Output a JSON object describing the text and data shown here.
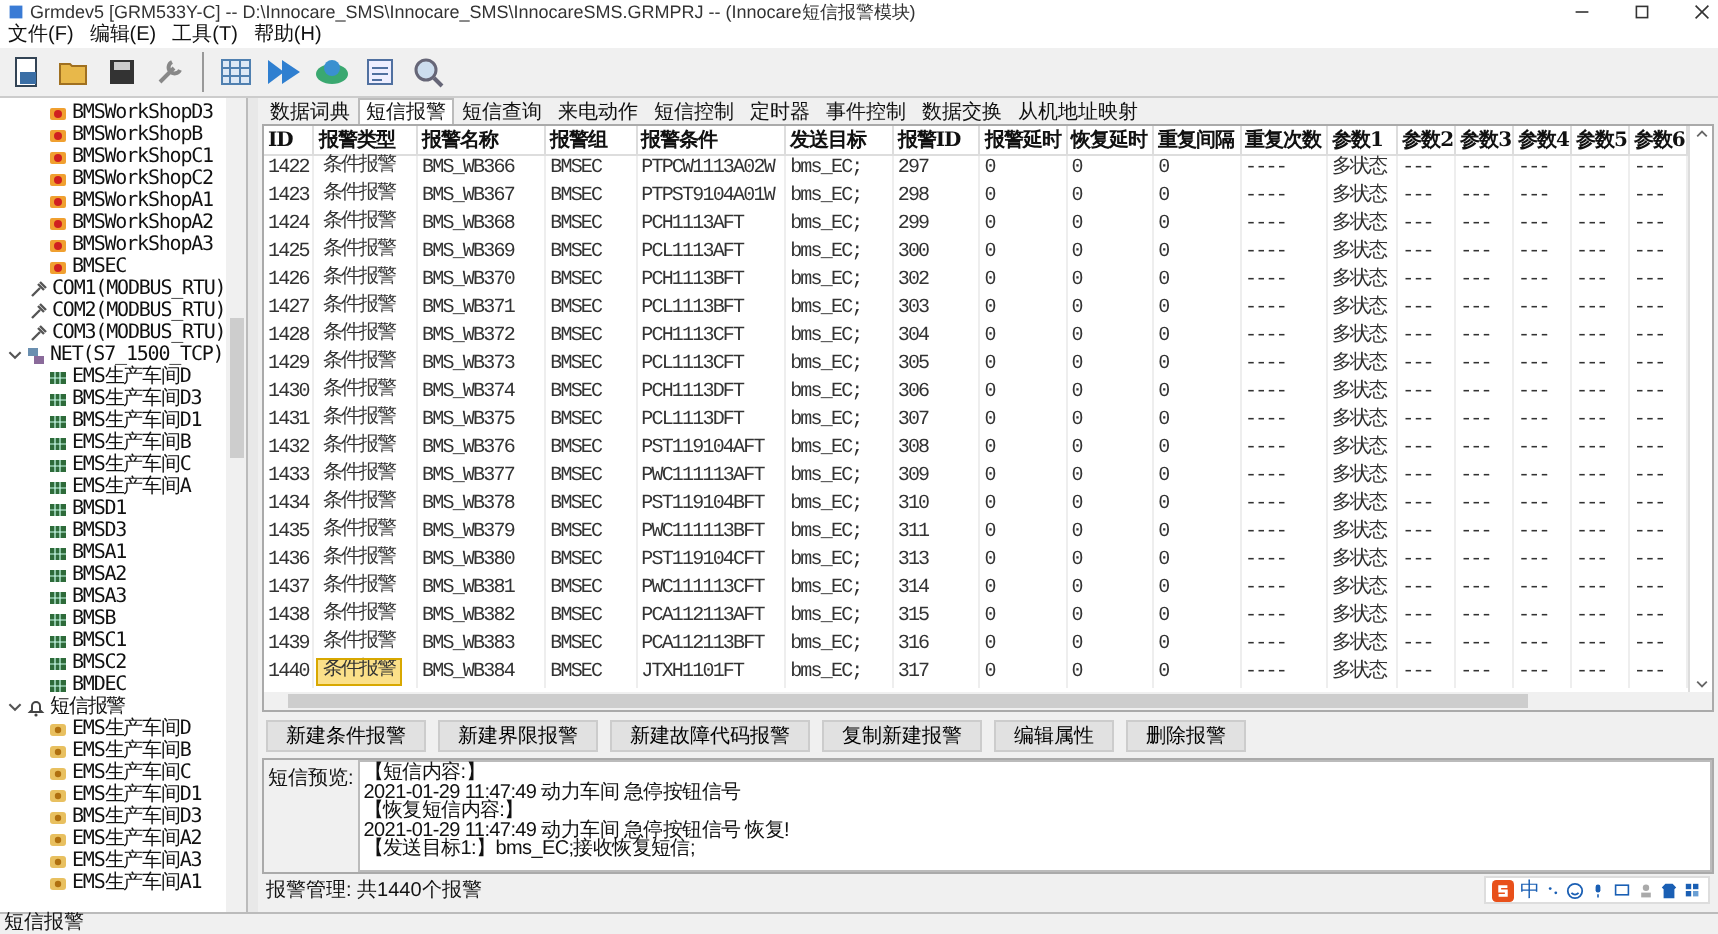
{
  "window": {
    "title": "Grmdev5 [GRM533Y-C] -- D:\\Innocare_SMS\\Innocare_SMS\\InnocareSMS.GRMPRJ -- (Innocare短信报警模块)"
  },
  "menu": [
    "文件(F)",
    "编辑(E)",
    "工具(T)",
    "帮助(H)"
  ],
  "tree": {
    "continued_items": [
      {
        "label": "BMSWorkShopD3",
        "kind": "device"
      },
      {
        "label": "BMSWorkShopB",
        "kind": "device"
      },
      {
        "label": "BMSWorkShopC1",
        "kind": "device"
      },
      {
        "label": "BMSWorkShopC2",
        "kind": "device"
      },
      {
        "label": "BMSWorkShopA1",
        "kind": "device"
      },
      {
        "label": "BMSWorkShopA2",
        "kind": "device"
      },
      {
        "label": "BMSWorkShopA3",
        "kind": "device"
      },
      {
        "label": "BMSEC",
        "kind": "device"
      }
    ],
    "nodes": [
      {
        "label": "COM1(MODBUS_RTU)",
        "kind": "port"
      },
      {
        "label": "COM2(MODBUS_RTU)",
        "kind": "port"
      },
      {
        "label": "COM3(MODBUS_RTU)",
        "kind": "port"
      },
      {
        "label": "NET(S7_1500_TCP)",
        "kind": "network",
        "expanded": true,
        "children": [
          {
            "label": "EMS生产车间D",
            "kind": "tag"
          },
          {
            "label": "BMS生产车间D3",
            "kind": "tag"
          },
          {
            "label": "BMS生产车间D1",
            "kind": "tag"
          },
          {
            "label": "EMS生产车间B",
            "kind": "tag"
          },
          {
            "label": "EMS生产车间C",
            "kind": "tag"
          },
          {
            "label": "EMS生产车间A",
            "kind": "tag"
          },
          {
            "label": "BMSD1",
            "kind": "tag"
          },
          {
            "label": "BMSD3",
            "kind": "tag"
          },
          {
            "label": "BMSA1",
            "kind": "tag"
          },
          {
            "label": "BMSA2",
            "kind": "tag"
          },
          {
            "label": "BMSA3",
            "kind": "tag"
          },
          {
            "label": "BMSB",
            "kind": "tag"
          },
          {
            "label": "BMSC1",
            "kind": "tag"
          },
          {
            "label": "BMSC2",
            "kind": "tag"
          },
          {
            "label": "BMDEC",
            "kind": "tag"
          }
        ]
      },
      {
        "label": "短信报警",
        "kind": "alarm",
        "expanded": true,
        "children": [
          {
            "label": "EMS生产车间D",
            "kind": "sms"
          },
          {
            "label": "EMS生产车间B",
            "kind": "sms"
          },
          {
            "label": "EMS生产车间C",
            "kind": "sms"
          },
          {
            "label": "EMS生产车间D1",
            "kind": "sms"
          },
          {
            "label": "BMS生产车间D3",
            "kind": "sms"
          },
          {
            "label": "EMS生产车间A2",
            "kind": "sms"
          },
          {
            "label": "EMS生产车间A3",
            "kind": "sms"
          },
          {
            "label": "EMS生产车间A1",
            "kind": "sms"
          }
        ]
      }
    ]
  },
  "tabs": [
    {
      "label": "数据词典",
      "selected": false
    },
    {
      "label": "短信报警",
      "selected": true
    },
    {
      "label": "短信查询",
      "selected": false
    },
    {
      "label": "来电动作",
      "selected": false
    },
    {
      "label": "短信控制",
      "selected": false
    },
    {
      "label": "定时器",
      "selected": false
    },
    {
      "label": "事件控制",
      "selected": false
    },
    {
      "label": "数据交换",
      "selected": false
    },
    {
      "label": "从机地址映射",
      "selected": false
    }
  ],
  "table": {
    "columns": [
      "ID",
      "报警类型",
      "报警名称",
      "报警组",
      "报警条件",
      "发送目标",
      "报警ID",
      "报警延时",
      "恢复延时",
      "重复间隔",
      "重复次数",
      "参数1",
      "参数2",
      "参数3",
      "参数4",
      "参数5",
      "参数6"
    ],
    "rows": [
      {
        "selected": false,
        "cells": [
          "1422",
          "条件报警",
          "BMS_WB366",
          "BMSEC",
          "PTPCW1113A02W",
          "bms_EC;",
          "297",
          "0",
          "0",
          "0",
          "----",
          "多状态",
          "---",
          "---",
          "---",
          "---",
          "---"
        ]
      },
      {
        "selected": false,
        "cells": [
          "1423",
          "条件报警",
          "BMS_WB367",
          "BMSEC",
          "PTPST9104A01W",
          "bms_EC;",
          "298",
          "0",
          "0",
          "0",
          "----",
          "多状态",
          "---",
          "---",
          "---",
          "---",
          "---"
        ]
      },
      {
        "selected": false,
        "cells": [
          "1424",
          "条件报警",
          "BMS_WB368",
          "BMSEC",
          "PCH1113AFT",
          "bms_EC;",
          "299",
          "0",
          "0",
          "0",
          "----",
          "多状态",
          "---",
          "---",
          "---",
          "---",
          "---"
        ]
      },
      {
        "selected": false,
        "cells": [
          "1425",
          "条件报警",
          "BMS_WB369",
          "BMSEC",
          "PCL1113AFT",
          "bms_EC;",
          "300",
          "0",
          "0",
          "0",
          "----",
          "多状态",
          "---",
          "---",
          "---",
          "---",
          "---"
        ]
      },
      {
        "selected": false,
        "cells": [
          "1426",
          "条件报警",
          "BMS_WB370",
          "BMSEC",
          "PCH1113BFT",
          "bms_EC;",
          "302",
          "0",
          "0",
          "0",
          "----",
          "多状态",
          "---",
          "---",
          "---",
          "---",
          "---"
        ]
      },
      {
        "selected": false,
        "cells": [
          "1427",
          "条件报警",
          "BMS_WB371",
          "BMSEC",
          "PCL1113BFT",
          "bms_EC;",
          "303",
          "0",
          "0",
          "0",
          "----",
          "多状态",
          "---",
          "---",
          "---",
          "---",
          "---"
        ]
      },
      {
        "selected": false,
        "cells": [
          "1428",
          "条件报警",
          "BMS_WB372",
          "BMSEC",
          "PCH1113CFT",
          "bms_EC;",
          "304",
          "0",
          "0",
          "0",
          "----",
          "多状态",
          "---",
          "---",
          "---",
          "---",
          "---"
        ]
      },
      {
        "selected": false,
        "cells": [
          "1429",
          "条件报警",
          "BMS_WB373",
          "BMSEC",
          "PCL1113CFT",
          "bms_EC;",
          "305",
          "0",
          "0",
          "0",
          "----",
          "多状态",
          "---",
          "---",
          "---",
          "---",
          "---"
        ]
      },
      {
        "selected": false,
        "cells": [
          "1430",
          "条件报警",
          "BMS_WB374",
          "BMSEC",
          "PCH1113DFT",
          "bms_EC;",
          "306",
          "0",
          "0",
          "0",
          "----",
          "多状态",
          "---",
          "---",
          "---",
          "---",
          "---"
        ]
      },
      {
        "selected": false,
        "cells": [
          "1431",
          "条件报警",
          "BMS_WB375",
          "BMSEC",
          "PCL1113DFT",
          "bms_EC;",
          "307",
          "0",
          "0",
          "0",
          "----",
          "多状态",
          "---",
          "---",
          "---",
          "---",
          "---"
        ]
      },
      {
        "selected": false,
        "cells": [
          "1432",
          "条件报警",
          "BMS_WB376",
          "BMSEC",
          "PST119104AFT",
          "bms_EC;",
          "308",
          "0",
          "0",
          "0",
          "----",
          "多状态",
          "---",
          "---",
          "---",
          "---",
          "---"
        ]
      },
      {
        "selected": false,
        "cells": [
          "1433",
          "条件报警",
          "BMS_WB377",
          "BMSEC",
          "PWC111113AFT",
          "bms_EC;",
          "309",
          "0",
          "0",
          "0",
          "----",
          "多状态",
          "---",
          "---",
          "---",
          "---",
          "---"
        ]
      },
      {
        "selected": false,
        "cells": [
          "1434",
          "条件报警",
          "BMS_WB378",
          "BMSEC",
          "PST119104BFT",
          "bms_EC;",
          "310",
          "0",
          "0",
          "0",
          "----",
          "多状态",
          "---",
          "---",
          "---",
          "---",
          "---"
        ]
      },
      {
        "selected": false,
        "cells": [
          "1435",
          "条件报警",
          "BMS_WB379",
          "BMSEC",
          "PWC111113BFT",
          "bms_EC;",
          "311",
          "0",
          "0",
          "0",
          "----",
          "多状态",
          "---",
          "---",
          "---",
          "---",
          "---"
        ]
      },
      {
        "selected": false,
        "cells": [
          "1436",
          "条件报警",
          "BMS_WB380",
          "BMSEC",
          "PST119104CFT",
          "bms_EC;",
          "313",
          "0",
          "0",
          "0",
          "----",
          "多状态",
          "---",
          "---",
          "---",
          "---",
          "---"
        ]
      },
      {
        "selected": false,
        "cells": [
          "1437",
          "条件报警",
          "BMS_WB381",
          "BMSEC",
          "PWC111113CFT",
          "bms_EC;",
          "314",
          "0",
          "0",
          "0",
          "----",
          "多状态",
          "---",
          "---",
          "---",
          "---",
          "---"
        ]
      },
      {
        "selected": false,
        "cells": [
          "1438",
          "条件报警",
          "BMS_WB382",
          "BMSEC",
          "PCA112113AFT",
          "bms_EC;",
          "315",
          "0",
          "0",
          "0",
          "----",
          "多状态",
          "---",
          "---",
          "---",
          "---",
          "---"
        ]
      },
      {
        "selected": false,
        "cells": [
          "1439",
          "条件报警",
          "BMS_WB383",
          "BMSEC",
          "PCA112113BFT",
          "bms_EC;",
          "316",
          "0",
          "0",
          "0",
          "----",
          "多状态",
          "---",
          "---",
          "---",
          "---",
          "---"
        ]
      },
      {
        "selected": true,
        "cells": [
          "1440",
          "条件报警",
          "BMS_WB384",
          "BMSEC",
          "JTXH1101FT",
          "bms_EC;",
          "317",
          "0",
          "0",
          "0",
          "----",
          "多状态",
          "---",
          "---",
          "---",
          "---",
          "---"
        ]
      }
    ]
  },
  "buttons": [
    "新建条件报警",
    "新建界限报警",
    "新建故障代码报警",
    "复制新建报警",
    "编辑属性",
    "删除报警"
  ],
  "preview": {
    "label": "短信预览:",
    "lines": [
      "【短信内容:】",
      "2021-01-29 11:47:49 动力车间 急停按钮信号",
      "【恢复短信内容:】",
      "2021-01-29 11:47:49 动力车间 急停按钮信号 恢复!",
      "【发送目标1:】bms_EC;接收恢复短信;"
    ]
  },
  "summary": "报警管理: 共1440个报警",
  "ime": {
    "mode": "中"
  },
  "status_bar": "短信报警"
}
